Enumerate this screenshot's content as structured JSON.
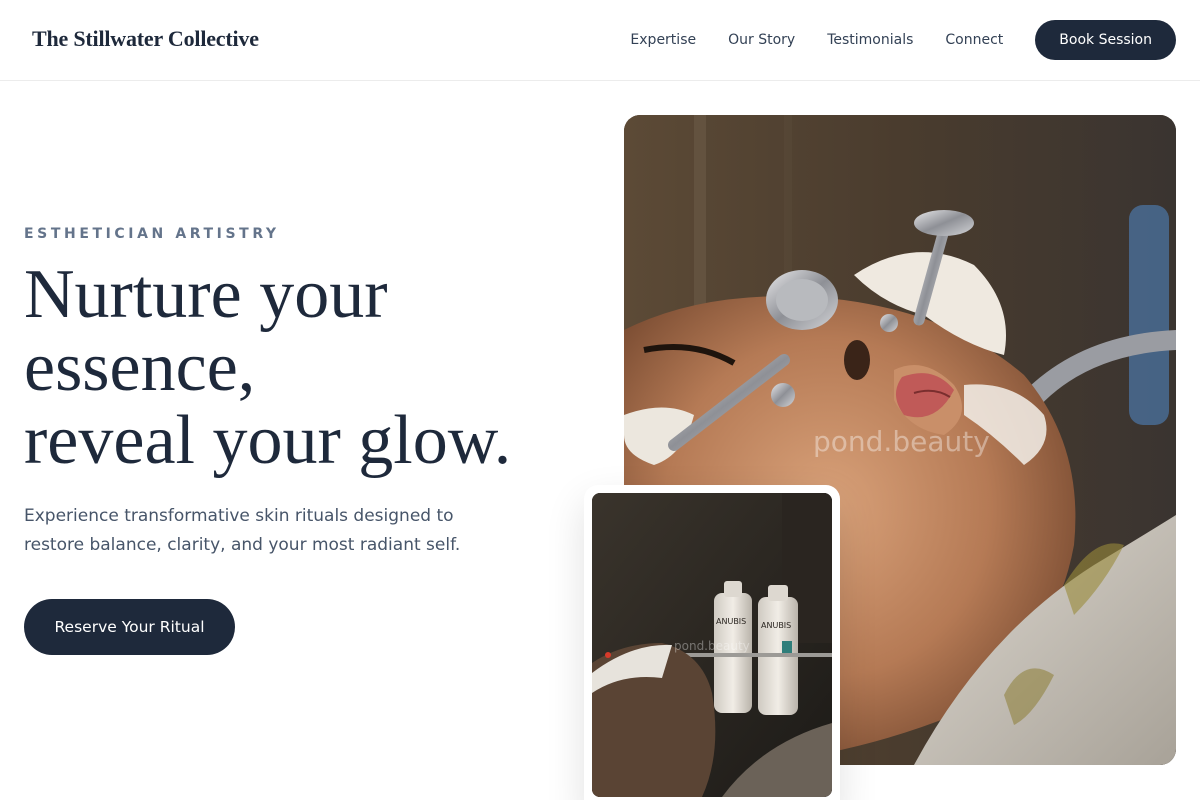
{
  "header": {
    "brand": "The Stillwater Collective",
    "nav": [
      "Expertise",
      "Our Story",
      "Testimonials",
      "Connect"
    ],
    "cta": "Book Session"
  },
  "hero": {
    "eyebrow": "ESTHETICIAN ARTISTRY",
    "headline": [
      "Nurture your",
      "essence,",
      "reveal your glow."
    ],
    "subtext": "Experience transformative skin rituals designed to restore balance, clarity, and your most radiant self.",
    "cta": "Reserve Your Ritual"
  },
  "images": {
    "main_watermark": "pond.beauty",
    "inset_watermark": "pond.beauty",
    "bottle_brand": "ANUBIS"
  },
  "colors": {
    "primary": "#1e293b",
    "muted_text": "#64748b",
    "body_text": "#475569",
    "background": "#ffffff"
  }
}
